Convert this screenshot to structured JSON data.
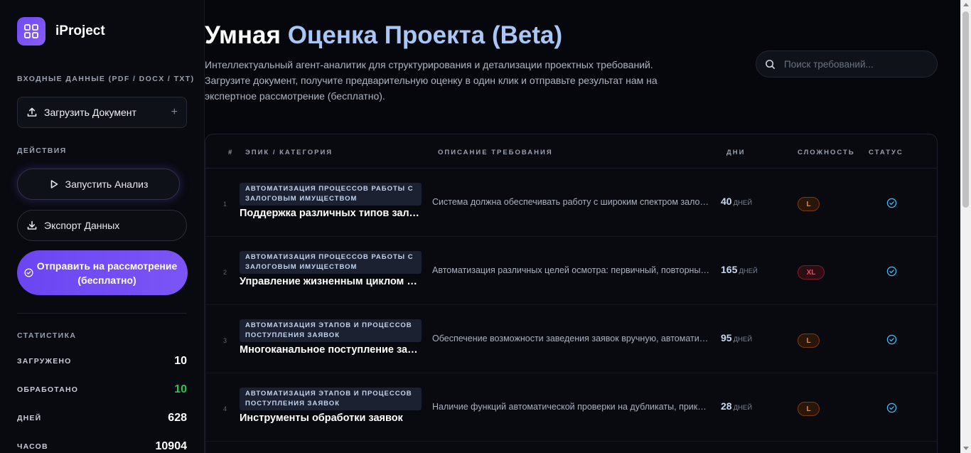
{
  "brand": {
    "name": "iProject",
    "icon": "grid-layout-icon",
    "accent": "#6d4cf5"
  },
  "sidebar": {
    "input_label": "ВХОДНЫЕ ДАННЫЕ (PDF / DOCX / TXT)",
    "upload_label": "Загрузить Документ",
    "actions_label": "ДЕЙСТВИЯ",
    "run_label": "Запустить Анализ",
    "export_label": "Экспорт Данных",
    "send_label_line1": "Отправить на рассмотрение",
    "send_label_line2": "(бесплатно)",
    "stats_label": "СТАТИСТИКА",
    "stats": [
      {
        "key": "ЗАГРУЖЕНО",
        "value": "10"
      },
      {
        "key": "ОБРАБОТАНО",
        "value": "10",
        "color": "#22c55e"
      },
      {
        "key": "ДНЕЙ",
        "value": "628"
      },
      {
        "key": "ЧАСОВ",
        "value": "10904"
      }
    ]
  },
  "header": {
    "title_part1": "Умная",
    "title_part2": "Оценка Проекта",
    "title_part3": "(Beta)",
    "subtitle": "Интеллектуальный агент-аналитик для структурирования и детализации проектных требований. Загрузите документ, получите предварительную оценку в один клик и отправьте результат нам на экспертное рассмотрение (бесплатно).",
    "search_placeholder": "Поиск требований..."
  },
  "table": {
    "columns": {
      "num": "#",
      "epic": "ЭПИК / КАТЕГОРИЯ",
      "desc": "ОПИСАНИЕ ТРЕБОВАНИЯ",
      "days": "ДНИ",
      "complexity": "СЛОЖНОСТЬ",
      "status": "СТАТУС"
    },
    "days_unit": "ДНЕЙ",
    "rows": [
      {
        "num": "1",
        "category": "АВТОМАТИЗАЦИЯ ПРОЦЕССОВ РАБОТЫ С ЗАЛОГОВЫМ ИМУЩЕСТВОМ",
        "name": "Поддержка различных типов залогового имущества",
        "desc": "Система должна обеспечивать работу с широким спектром залогового имущества",
        "days": "40",
        "complexity": "L",
        "status": "check-circle-icon"
      },
      {
        "num": "2",
        "category": "АВТОМАТИЗАЦИЯ ПРОЦЕССОВ РАБОТЫ С ЗАЛОГОВЫМ ИМУЩЕСТВОМ",
        "name": "Управление жизненным циклом осмотров",
        "desc": "Автоматизация различных целей осмотра: первичный, повторный, внеплановый",
        "days": "165",
        "complexity": "XL",
        "status": "check-circle-icon"
      },
      {
        "num": "3",
        "category": "АВТОМАТИЗАЦИЯ ЭТАПОВ И ПРОЦЕССОВ ПОСТУПЛЕНИЯ ЗАЯВОК",
        "name": "Многоканальное поступление заявок",
        "desc": "Обеспечение возможности заведения заявок вручную, автоматически из внешних систем",
        "days": "95",
        "complexity": "L",
        "status": "check-circle-icon"
      },
      {
        "num": "4",
        "category": "АВТОМАТИЗАЦИЯ ЭТАПОВ И ПРОЦЕССОВ ПОСТУПЛЕНИЯ ЗАЯВОК",
        "name": "Инструменты обработки заявок",
        "desc": "Наличие функций автоматической проверки на дубликаты, прикрепления документов",
        "days": "28",
        "complexity": "L",
        "status": "check-circle-icon"
      }
    ]
  },
  "colors": {
    "background": "#05070c",
    "title_highlight": "#a9c6f5",
    "badge_L": "#f08a24",
    "badge_XL": "#f04b5f",
    "status_check": "#38bdf8"
  }
}
